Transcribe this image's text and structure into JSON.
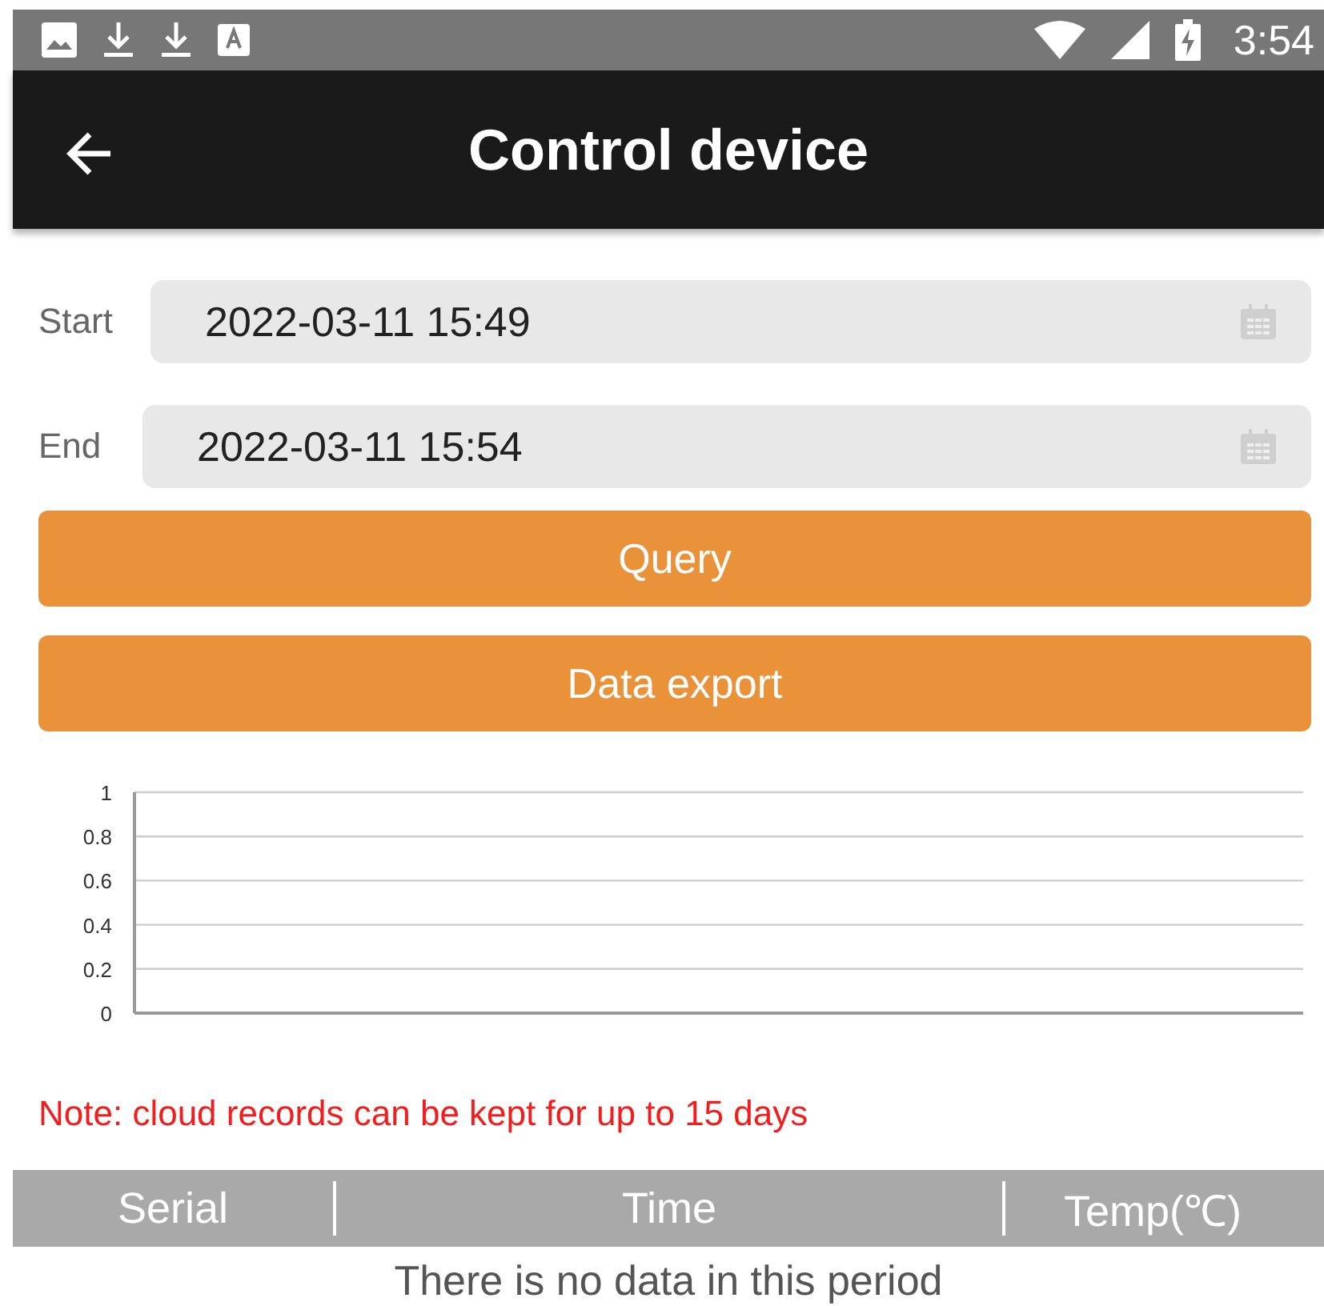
{
  "status_bar": {
    "time": "3:54"
  },
  "header": {
    "title": "Control device"
  },
  "fields": [
    {
      "label": "Start",
      "value": "2022-03-11 15:49"
    },
    {
      "label": "End",
      "value": "2022-03-11 15:54"
    }
  ],
  "buttons": [
    "Query",
    "Data export"
  ],
  "chart": {
    "y_axis_labels": [
      "1",
      "0.8",
      "0.6",
      "0.4",
      "0.2",
      "0"
    ]
  },
  "note": "Note: cloud records can be kept for up to 15 days",
  "table": {
    "columns": [
      "Serial",
      "Time",
      "Temp(℃)"
    ],
    "empty_message": "There is no data in this period"
  }
}
